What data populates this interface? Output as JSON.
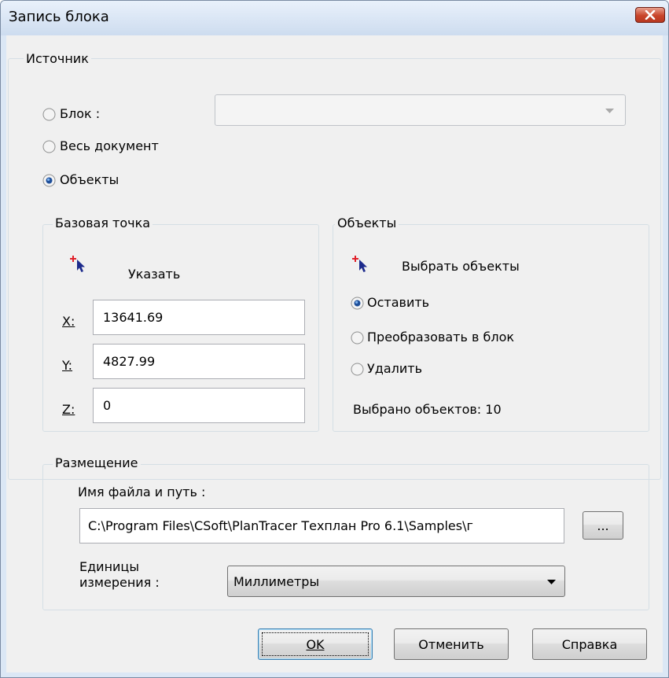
{
  "window": {
    "title": "Запись блока"
  },
  "source": {
    "legend": "Источник",
    "options": [
      {
        "label": "Блок :",
        "selected": false
      },
      {
        "label": "Весь документ",
        "selected": false
      },
      {
        "label": "Объекты",
        "selected": true
      }
    ],
    "block_combo_value": ""
  },
  "base_point": {
    "legend": "Базовая точка",
    "pick_label": "Указать",
    "x": {
      "label": "X:",
      "value": "13641.69"
    },
    "y": {
      "label": "Y:",
      "value": "4827.99"
    },
    "z": {
      "label": "Z:",
      "value": "0"
    }
  },
  "objects": {
    "legend": "Объекты",
    "select_label": "Выбрать объекты",
    "options": [
      {
        "label": "Оставить",
        "selected": true
      },
      {
        "label": "Преобразовать в блок",
        "selected": false
      },
      {
        "label": "Удалить",
        "selected": false
      }
    ],
    "selected_count_label": "Выбрано объектов: 10"
  },
  "placement": {
    "legend": "Размещение",
    "path_label": "Имя файла и путь :",
    "path_value": "C:\\Program Files\\CSoft\\PlanTracer Техплан Pro 6.1\\Samples\\г",
    "browse_label": "...",
    "units_label": "Единицы\nизмерения :",
    "units_value": "Миллиметры"
  },
  "buttons": {
    "ok": "OK",
    "cancel": "Отменить",
    "help": "Справка"
  }
}
